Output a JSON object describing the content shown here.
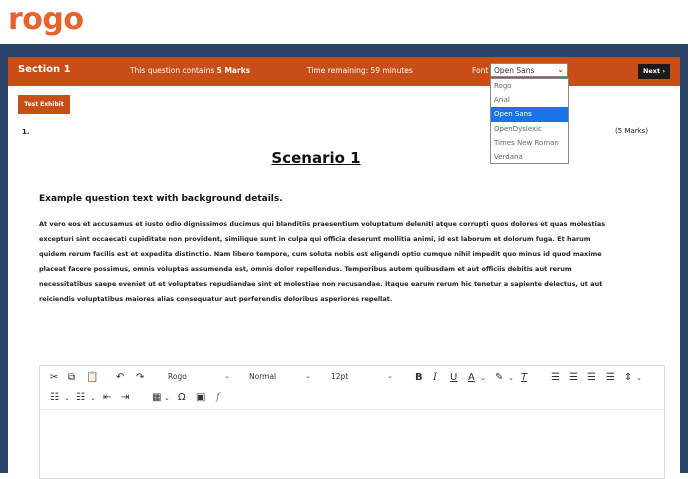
{
  "logo": "rogo",
  "header": {
    "section": "Section 1",
    "marks_prefix": "This question contains ",
    "marks_value": "5 Marks",
    "time_remaining": "Time remaining: 59 minutes",
    "font_label": "Font",
    "font_selected": "Open Sans",
    "next_label": "Next ›"
  },
  "font_options": [
    "Rogo",
    "Arial",
    "Open Sans",
    "OpenDyslexic",
    "Times New Roman",
    "Verdana"
  ],
  "exhibit_button": "Test Exhibit",
  "question": {
    "number": "1.",
    "marks": "(5 Marks)",
    "scenario_title": "Scenario 1",
    "heading": "Example question text with background details.",
    "body": "At vero eos et accusamus et iusto odio dignissimos ducimus qui blanditiis praesentium voluptatum deleniti atque corrupti quos dolores et quas molestias excepturi sint occaecati cupiditate non provident, similique sunt in culpa qui officia deserunt mollitia animi, id est laborum et dolorum fuga. Et harum quidem rerum facilis est et expedita distinctio. Nam libero tempore, cum soluta nobis est eligendi optio cumque nihil impedit quo minus id quod maxime placeat facere possimus, omnis voluptas assumenda est, omnis dolor repellendus. Temporibus autem quibusdam et aut officiis debitis aut rerum necessitatibus saepe eveniet ut et voluptates repudiandae sint et molestiae non recusandae. Itaque earum rerum hic tenetur a sapiente delectus, ut aut reiciendis voluptatibus maiores alias consequatur aut perferendis doloribus asperiores repellat."
  },
  "editor": {
    "font_family": "Rogo",
    "block_format": "Normal",
    "font_size": "12pt"
  },
  "colors": {
    "brand": "#e8622e",
    "header": "#c94d16",
    "frame": "#2c4369",
    "selection": "#1a73e8"
  }
}
